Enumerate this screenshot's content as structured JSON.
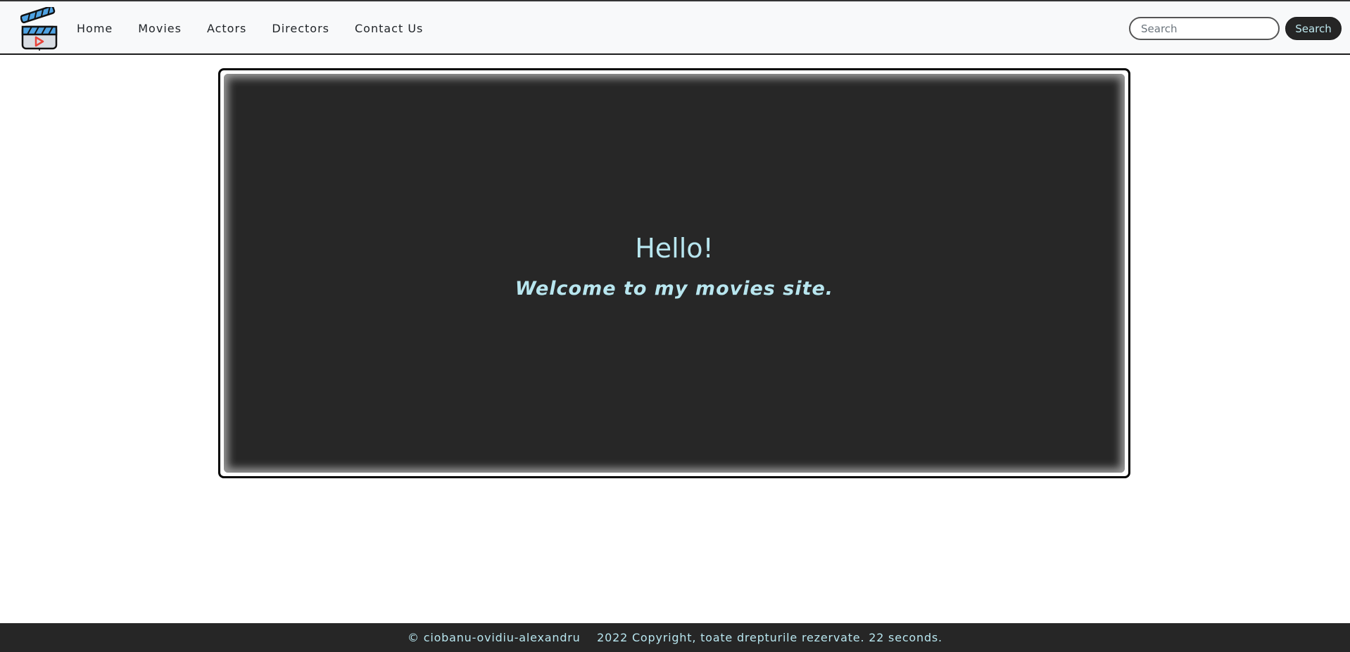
{
  "nav": {
    "logo_icon": "movie-clapperboard-icon",
    "links": [
      "Home",
      "Movies",
      "Actors",
      "Directors",
      "Contact Us"
    ],
    "search_placeholder": "Search",
    "search_button": "Search"
  },
  "hero": {
    "title": "Hello!",
    "subtitle": "Welcome to my movies site."
  },
  "footer": {
    "text": "© ciobanu-ovidiu-alexandru    2022 Copyright, toate drepturile rezervate. 22 seconds."
  },
  "colors": {
    "navbar_bg": "#f8f9fa",
    "hero_bg": "#272727",
    "accent_text": "#b8e6ef",
    "footer_bg": "#262626",
    "logo_stripe": "#4fa3e3",
    "play_red": "#e8443a"
  }
}
